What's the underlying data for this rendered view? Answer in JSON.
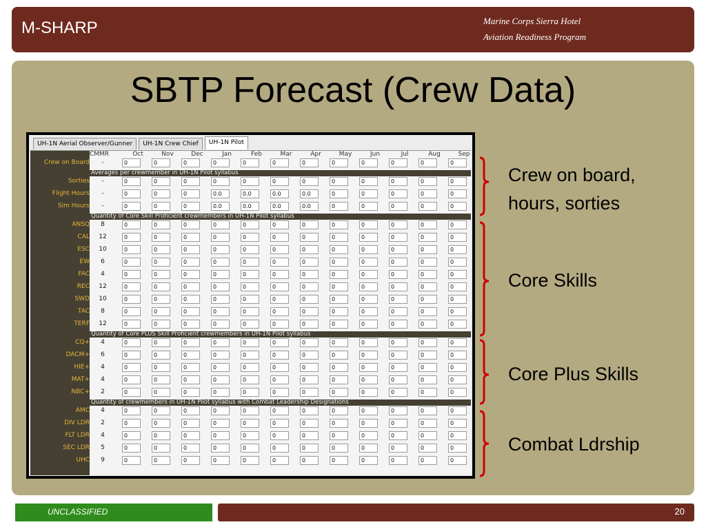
{
  "header": {
    "brand": "M-SHARP",
    "subtitle_line1": "Marine Corps Sierra Hotel",
    "subtitle_line2": "Aviation Readiness Program"
  },
  "slide_title": "SBTP Forecast (Crew Data)",
  "app": {
    "tabs": [
      {
        "label": "UH-1N Aerial Observer/Gunner",
        "active": false
      },
      {
        "label": "UH-1N Crew Chief",
        "active": false
      },
      {
        "label": "UH-1N Pilot",
        "active": true
      }
    ],
    "columns": [
      "CMMR",
      "Oct",
      "Nov",
      "Dec",
      "Jan",
      "Feb",
      "Mar",
      "Apr",
      "May",
      "Jun",
      "Jul",
      "Aug",
      "Sep"
    ],
    "rows": [
      {
        "kind": "row",
        "label": "Crew on Board",
        "cmmr": "-",
        "values": [
          "0",
          "0",
          "0",
          "0",
          "0",
          "0",
          "0",
          "0",
          "0",
          "0",
          "0",
          "0"
        ]
      },
      {
        "kind": "section",
        "label": "Averages per crewmember in UH-1N Pilot syllabus"
      },
      {
        "kind": "row",
        "label": "Sorties",
        "cmmr": "-",
        "values": [
          "0",
          "0",
          "0",
          "0",
          "0",
          "0",
          "0",
          "0",
          "0",
          "0",
          "0",
          "0"
        ]
      },
      {
        "kind": "row",
        "label": "Flight Hours",
        "cmmr": "-",
        "values": [
          "0",
          "0",
          "0",
          "0.0",
          "0.0",
          "0.0",
          "0.0",
          "0",
          "0",
          "0",
          "0",
          "0"
        ]
      },
      {
        "kind": "row",
        "label": "Sim Hours",
        "cmmr": "-",
        "values": [
          "0",
          "0",
          "0",
          "0.0",
          "0.0",
          "0.0",
          "0.0",
          "0",
          "0",
          "0",
          "0",
          "0"
        ]
      },
      {
        "kind": "section",
        "label": "Quantity of Core Skill Proficient crewmembers in UH-1N Pilot syllabus"
      },
      {
        "kind": "row",
        "label": "ANSQ",
        "cmmr": "8",
        "values": [
          "0",
          "0",
          "0",
          "0",
          "0",
          "0",
          "0",
          "0",
          "0",
          "0",
          "0",
          "0"
        ]
      },
      {
        "kind": "row",
        "label": "CAL",
        "cmmr": "12",
        "values": [
          "0",
          "0",
          "0",
          "0",
          "0",
          "0",
          "0",
          "0",
          "0",
          "0",
          "0",
          "0"
        ]
      },
      {
        "kind": "row",
        "label": "ESC",
        "cmmr": "10",
        "values": [
          "0",
          "0",
          "0",
          "0",
          "0",
          "0",
          "0",
          "0",
          "0",
          "0",
          "0",
          "0"
        ]
      },
      {
        "kind": "row",
        "label": "EW",
        "cmmr": "6",
        "values": [
          "0",
          "0",
          "0",
          "0",
          "0",
          "0",
          "0",
          "0",
          "0",
          "0",
          "0",
          "0"
        ]
      },
      {
        "kind": "row",
        "label": "FAC",
        "cmmr": "4",
        "values": [
          "0",
          "0",
          "0",
          "0",
          "0",
          "0",
          "0",
          "0",
          "0",
          "0",
          "0",
          "0"
        ]
      },
      {
        "kind": "row",
        "label": "REC",
        "cmmr": "12",
        "values": [
          "0",
          "0",
          "0",
          "0",
          "0",
          "0",
          "0",
          "0",
          "0",
          "0",
          "0",
          "0"
        ]
      },
      {
        "kind": "row",
        "label": "SWD",
        "cmmr": "10",
        "values": [
          "0",
          "0",
          "0",
          "0",
          "0",
          "0",
          "0",
          "0",
          "0",
          "0",
          "0",
          "0"
        ]
      },
      {
        "kind": "row",
        "label": "TAC",
        "cmmr": "8",
        "values": [
          "0",
          "0",
          "0",
          "0",
          "0",
          "0",
          "0",
          "0",
          "0",
          "0",
          "0",
          "0"
        ]
      },
      {
        "kind": "row",
        "label": "TERF",
        "cmmr": "12",
        "values": [
          "0",
          "0",
          "0",
          "0",
          "0",
          "0",
          "0",
          "0",
          "0",
          "0",
          "0",
          "0"
        ]
      },
      {
        "kind": "section",
        "label": "Quantity of Core PLUS Skill Proficient crewmembers in UH-1N Pilot syllabus"
      },
      {
        "kind": "row",
        "label": "CQ+",
        "cmmr": "4",
        "values": [
          "0",
          "0",
          "0",
          "0",
          "0",
          "0",
          "0",
          "0",
          "0",
          "0",
          "0",
          "0"
        ]
      },
      {
        "kind": "row",
        "label": "DACM+",
        "cmmr": "6",
        "values": [
          "0",
          "0",
          "0",
          "0",
          "0",
          "0",
          "0",
          "0",
          "0",
          "0",
          "0",
          "0"
        ]
      },
      {
        "kind": "row",
        "label": "HIE+",
        "cmmr": "4",
        "values": [
          "0",
          "0",
          "0",
          "0",
          "0",
          "0",
          "0",
          "0",
          "0",
          "0",
          "0",
          "0"
        ]
      },
      {
        "kind": "row",
        "label": "MAT+",
        "cmmr": "4",
        "values": [
          "0",
          "0",
          "0",
          "0",
          "0",
          "0",
          "0",
          "0",
          "0",
          "0",
          "0",
          "0"
        ]
      },
      {
        "kind": "row",
        "label": "NBC+",
        "cmmr": "2",
        "values": [
          "0",
          "0",
          "0",
          "0",
          "0",
          "0",
          "0",
          "0",
          "0",
          "0",
          "0",
          "0"
        ]
      },
      {
        "kind": "section",
        "label": "Quantity of crewmembers in UH-1N Pilot syllabus with Combat Leadership Designations"
      },
      {
        "kind": "row",
        "label": "AMC",
        "cmmr": "4",
        "values": [
          "0",
          "0",
          "0",
          "0",
          "0",
          "0",
          "0",
          "0",
          "0",
          "0",
          "0",
          "0"
        ]
      },
      {
        "kind": "row",
        "label": "DIV LDR",
        "cmmr": "2",
        "values": [
          "0",
          "0",
          "0",
          "0",
          "0",
          "0",
          "0",
          "0",
          "0",
          "0",
          "0",
          "0"
        ]
      },
      {
        "kind": "row",
        "label": "FLT LDR",
        "cmmr": "4",
        "values": [
          "0",
          "0",
          "0",
          "0",
          "0",
          "0",
          "0",
          "0",
          "0",
          "0",
          "0",
          "0"
        ]
      },
      {
        "kind": "row",
        "label": "SEC LDR",
        "cmmr": "5",
        "values": [
          "0",
          "0",
          "0",
          "0",
          "0",
          "0",
          "0",
          "0",
          "0",
          "0",
          "0",
          "0"
        ]
      },
      {
        "kind": "row",
        "label": "UHC",
        "cmmr": "9",
        "values": [
          "0",
          "0",
          "0",
          "0",
          "0",
          "0",
          "0",
          "0",
          "0",
          "0",
          "0",
          "0"
        ]
      }
    ]
  },
  "callouts": [
    {
      "lines": [
        "Crew on board,",
        "hours, sorties"
      ]
    },
    {
      "lines": [
        "Core Skills"
      ]
    },
    {
      "lines": [
        "Core Plus Skills"
      ]
    },
    {
      "lines": [
        "Combat Ldrship"
      ]
    }
  ],
  "footer": {
    "classification": "UNCLASSIFIED",
    "page_number": "20"
  },
  "colors": {
    "header_bg": "#6e2a1f",
    "panel_bg": "#b4aa82",
    "label_column_bg": "#454032",
    "label_text": "#e6b53c",
    "brace": "#d00000",
    "footer_green": "#2f8c1c"
  }
}
